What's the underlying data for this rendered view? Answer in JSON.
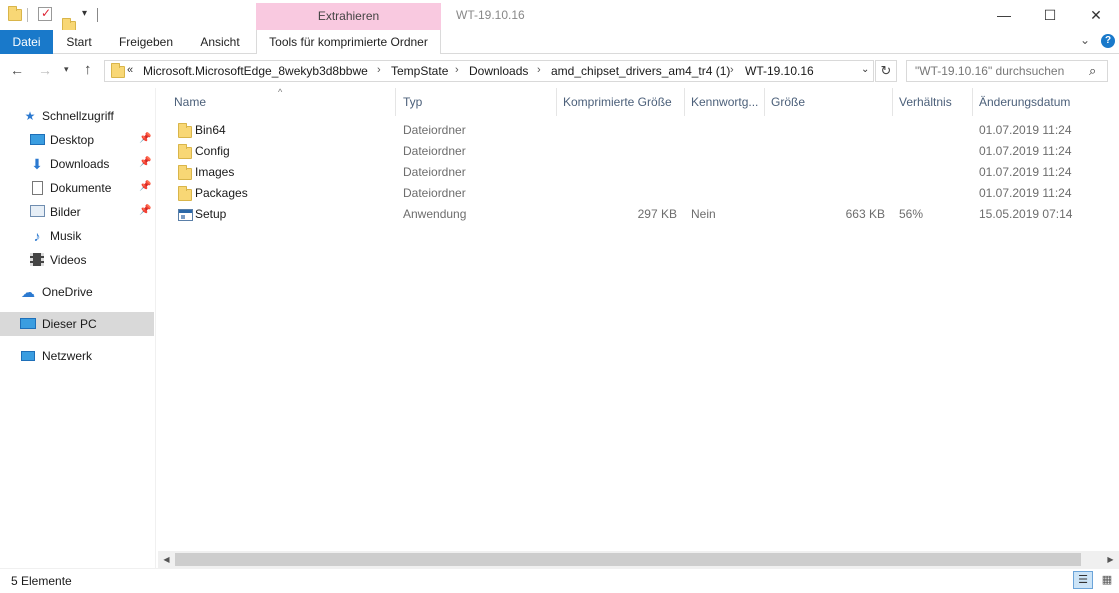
{
  "window": {
    "title": "WT-19.10.16",
    "contextual_group": "Extrahieren",
    "controls": {
      "minimize": "—",
      "maximize": "☐",
      "close": "✕"
    }
  },
  "ribbon": {
    "tabs": [
      {
        "label": "Datei",
        "active": true
      },
      {
        "label": "Start"
      },
      {
        "label": "Freigeben"
      },
      {
        "label": "Ansicht"
      },
      {
        "label": "Tools für komprimierte Ordner"
      }
    ],
    "expand_icon": "chevron-down-icon",
    "help_icon": "?"
  },
  "address": {
    "overflow": "«",
    "crumbs": [
      "Microsoft.MicrosoftEdge_8wekyb3d8bbwe",
      "TempState",
      "Downloads",
      "amd_chipset_drivers_am4_tr4 (1)",
      "WT-19.10.16"
    ],
    "separator": "›",
    "search_placeholder": "\"WT-19.10.16\" durchsuchen"
  },
  "sidebar": {
    "items": [
      {
        "label": "Schnellzugriff",
        "icon": "star-icon",
        "pinned": false
      },
      {
        "label": "Desktop",
        "icon": "desktop-icon",
        "pinned": true
      },
      {
        "label": "Downloads",
        "icon": "download-icon",
        "pinned": true
      },
      {
        "label": "Dokumente",
        "icon": "document-icon",
        "pinned": true
      },
      {
        "label": "Bilder",
        "icon": "picture-icon",
        "pinned": true
      },
      {
        "label": "Musik",
        "icon": "music-icon",
        "pinned": false
      },
      {
        "label": "Videos",
        "icon": "video-icon",
        "pinned": false
      },
      {
        "label": "OneDrive",
        "icon": "cloud-icon",
        "pinned": false
      },
      {
        "label": "Dieser PC",
        "icon": "computer-icon",
        "pinned": false,
        "selected": true
      },
      {
        "label": "Netzwerk",
        "icon": "network-icon",
        "pinned": false
      }
    ]
  },
  "table": {
    "columns": [
      "Name",
      "Typ",
      "Komprimierte Größe",
      "Kennwortg...",
      "Größe",
      "Verhältnis",
      "Änderungsdatum"
    ],
    "rows": [
      {
        "name": "Bin64",
        "type": "Dateiordner",
        "compressed": "",
        "password": "",
        "size": "",
        "ratio": "",
        "date": "01.07.2019 11:24",
        "icon": "folder-icon"
      },
      {
        "name": "Config",
        "type": "Dateiordner",
        "compressed": "",
        "password": "",
        "size": "",
        "ratio": "",
        "date": "01.07.2019 11:24",
        "icon": "folder-icon"
      },
      {
        "name": "Images",
        "type": "Dateiordner",
        "compressed": "",
        "password": "",
        "size": "",
        "ratio": "",
        "date": "01.07.2019 11:24",
        "icon": "folder-icon"
      },
      {
        "name": "Packages",
        "type": "Dateiordner",
        "compressed": "",
        "password": "",
        "size": "",
        "ratio": "",
        "date": "01.07.2019 11:24",
        "icon": "folder-icon"
      },
      {
        "name": "Setup",
        "type": "Anwendung",
        "compressed": "297 KB",
        "password": "Nein",
        "size": "663 KB",
        "ratio": "56%",
        "date": "15.05.2019 07:14",
        "icon": "application-icon"
      }
    ]
  },
  "status": {
    "count": "5 Elemente"
  },
  "colors": {
    "accent": "#1979ca",
    "contextual_tab": "#f9c9e0",
    "selected_nav": "#d9d9d9",
    "column_header_text": "#4c607a"
  }
}
